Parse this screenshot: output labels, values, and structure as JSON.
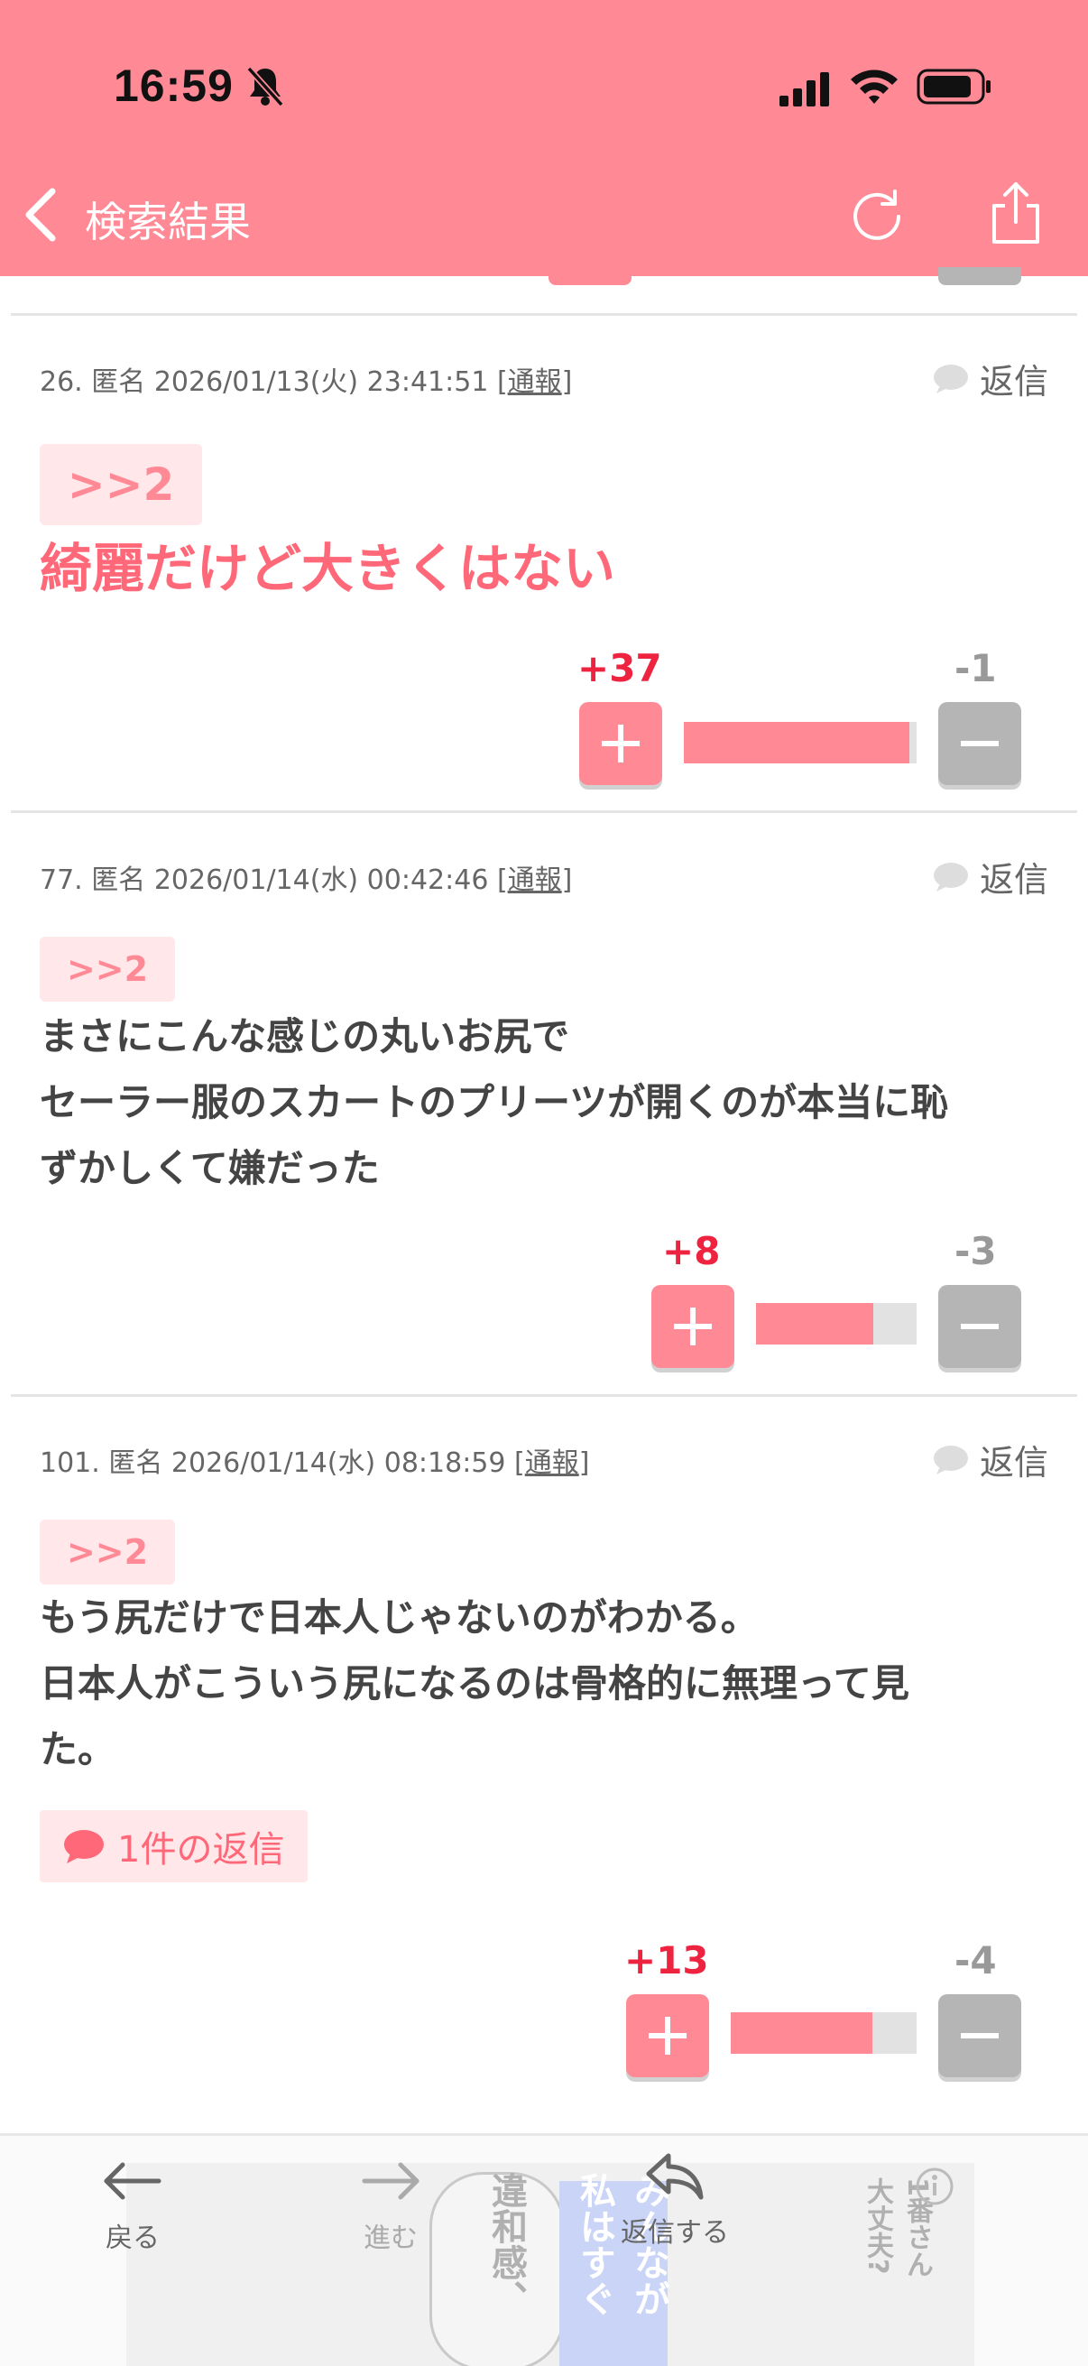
{
  "status_bar": {
    "time": "16:59"
  },
  "nav": {
    "title": "検索結果"
  },
  "posts": [
    {
      "number": "26.",
      "author": "匿名",
      "datetime": "2026/01/13(火) 23:41:51",
      "report": "通報",
      "reply": "返信",
      "anchor": ">>2",
      "body": "綺麗だけど大きくはない",
      "plus": "+37",
      "minus": "-1",
      "plus_ratio": 0.97
    },
    {
      "number": "77.",
      "author": "匿名",
      "datetime": "2026/01/14(水) 00:42:46",
      "report": "通報",
      "reply": "返信",
      "anchor": ">>2",
      "body": "まさにこんな感じの丸いお尻で\nセーラー服のスカートのプリーツが開くのが本当に恥\nずかしくて嫌だった",
      "plus": "+8",
      "minus": "-3",
      "plus_ratio": 0.73
    },
    {
      "number": "101.",
      "author": "匿名",
      "datetime": "2026/01/14(水) 08:18:59",
      "report": "通報",
      "reply": "返信",
      "anchor": ">>2",
      "body": "もう尻だけで日本人じゃないのがわかる。\n日本人がこういう尻になるのは骨格的に無理って見\nた。",
      "replies": "1件の返信",
      "plus": "+13",
      "minus": "-4",
      "plus_ratio": 0.76
    }
  ],
  "toolbar": {
    "back": "戻る",
    "forward": "進む",
    "reply": "返信する"
  },
  "ad": {
    "text_1": "違和感、",
    "text_2": "みんなが",
    "text_3": "私はすぐ",
    "text_4": "1番さん\n大丈夫?"
  },
  "colors": {
    "accent": "#ff8a96",
    "plus": "#ee2340",
    "minus_btn": "#b5b5b5"
  }
}
